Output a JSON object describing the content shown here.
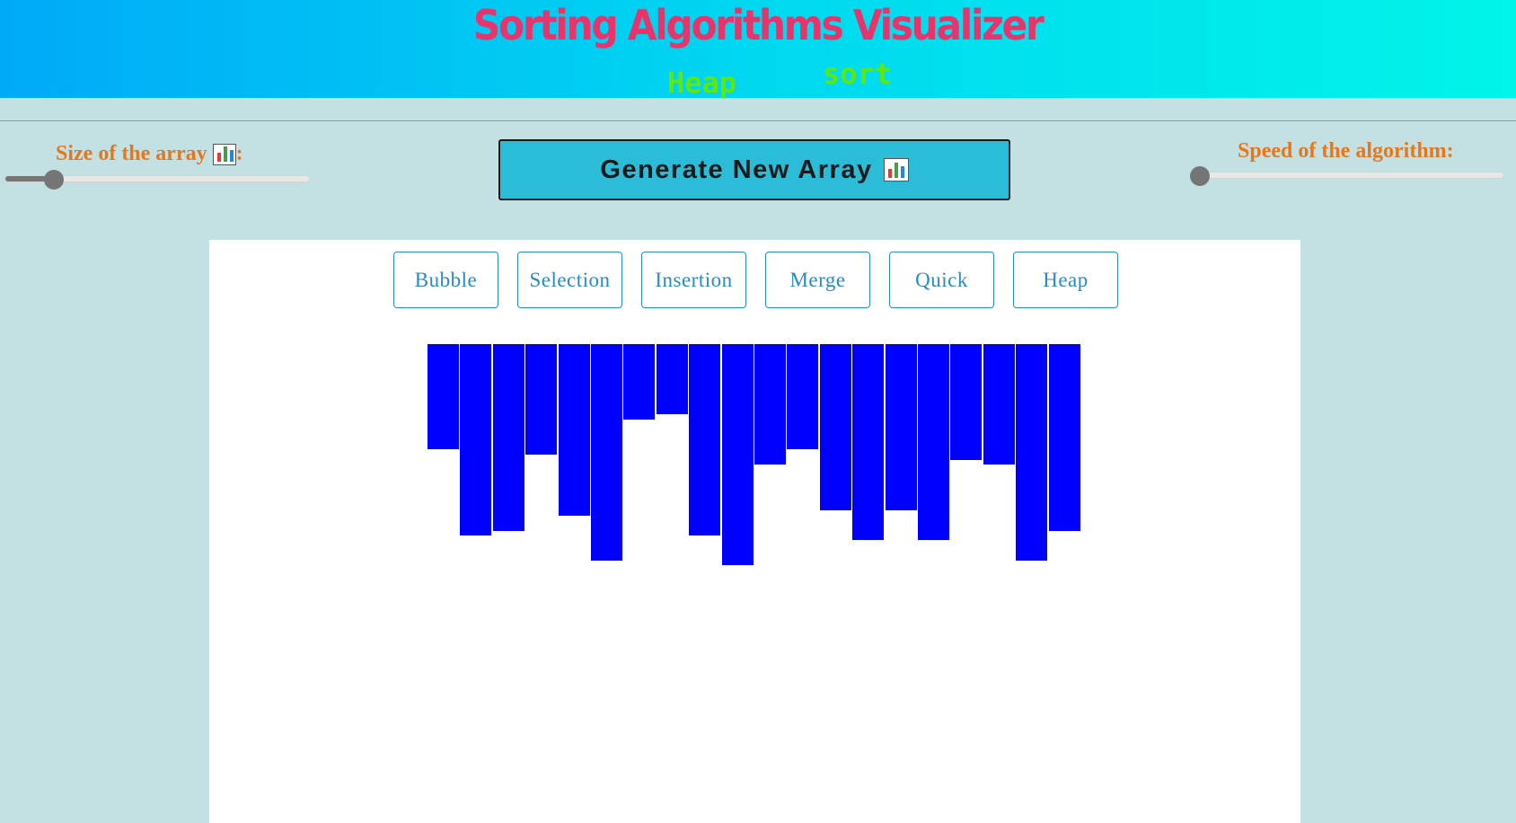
{
  "header": {
    "title": "Sorting Algorithms Visualizer",
    "subtitle_word1": "Heap",
    "subtitle_word2": "sort"
  },
  "controls": {
    "size_label": "Size of the array",
    "size_label_suffix": ":",
    "size_icon": "bar-chart-icon",
    "size_slider_fraction": 0.16,
    "speed_label": "Speed of the algorithm:",
    "speed_slider_fraction": 0.0,
    "generate_label": "Generate New Array",
    "generate_icon": "bar-chart-icon"
  },
  "algorithms": [
    "Bubble",
    "Selection",
    "Insertion",
    "Merge",
    "Quick",
    "Heap"
  ],
  "array": {
    "bar_color": "#0000ff",
    "values": [
      117,
      213,
      208,
      123,
      191,
      241,
      84,
      78,
      213,
      246,
      134,
      117,
      185,
      218,
      185,
      218,
      129,
      134,
      241,
      208
    ]
  },
  "colors": {
    "title": "#e8336b",
    "subtitle": "#5fe80c",
    "label": "#e8771a",
    "button_bg": "#2bbcd8",
    "algo_button_text": "#2a8bc0",
    "page_bg": "#c3e1e2"
  }
}
